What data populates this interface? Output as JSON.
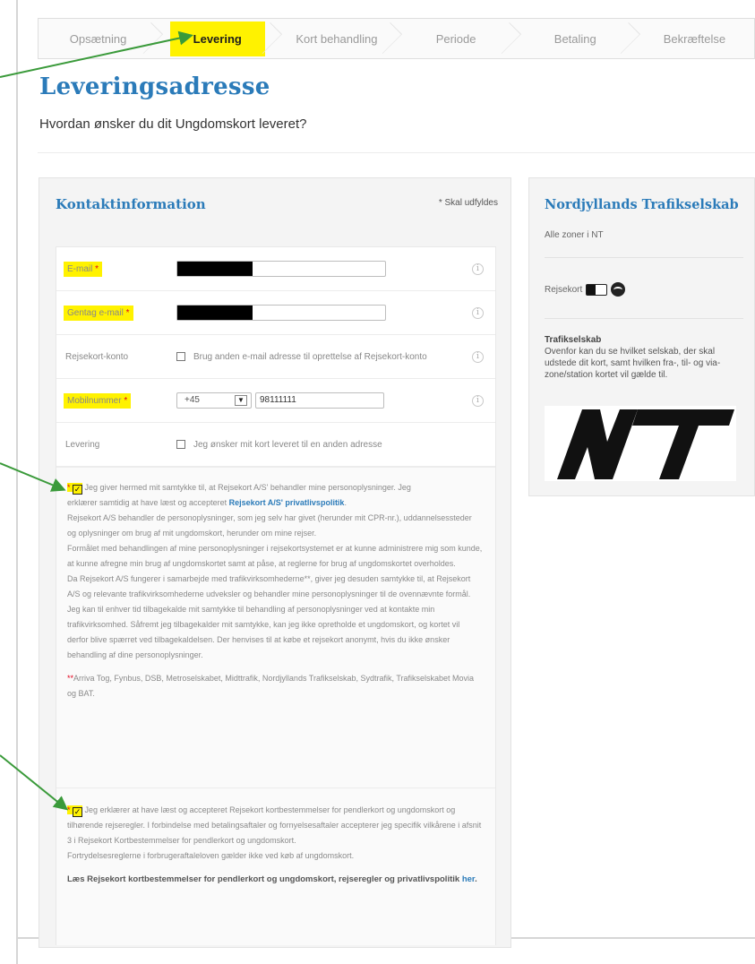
{
  "steps": [
    {
      "label": "Opsætning",
      "active": false
    },
    {
      "label": "Levering",
      "active": true
    },
    {
      "label": "Kort behandling",
      "active": false
    },
    {
      "label": "Periode",
      "active": false
    },
    {
      "label": "Betaling",
      "active": false
    },
    {
      "label": "Bekræftelse",
      "active": false
    }
  ],
  "page": {
    "title": "Leveringsadresse",
    "subtitle": "Hvordan ønsker du dit Ungdomskort leveret?"
  },
  "contact": {
    "title": "Kontaktinformation",
    "required_note": "* Skal udfyldes",
    "email_label": "E-mail",
    "repeat_email_label": "Gentag e-mail",
    "account_label": "Rejsekort-konto",
    "account_checkbox_text": "Brug anden e-mail adresse til oprettelse af Rejsekort-konto",
    "mobile_label": "Mobilnummer",
    "country_code": "+45",
    "mobile_value": "98111111",
    "delivery_label": "Levering",
    "delivery_checkbox_text": "Jeg ønsker mit kort leveret til en anden adresse",
    "required_star": "*"
  },
  "consent1": {
    "line1": "Jeg giver hermed mit samtykke til, at Rejsekort A/S' behandler mine personoplysninger. Jeg",
    "line2_a": "erklærer samtidig at have læst og accepteret ",
    "line2_link": "Rejsekort A/S' privatlivspolitik",
    "p2": "Rejsekort A/S behandler de personoplysninger, som jeg selv har givet (herunder mit CPR-nr.), uddannelsessteder og oplysninger om brug af mit ungdomskort, herunder om mine rejser.",
    "p3": "Formålet med behandlingen af mine personoplysninger i rejsekortsystemet er at kunne administrere mig som kunde, at kunne afregne min brug af ungdomskortet samt at påse, at reglerne for brug af ungdomskortet overholdes.",
    "p4": "Da Rejsekort A/S fungerer i samarbejde med trafikvirksomhederne**, giver jeg desuden samtykke til, at Rejsekort A/S og relevante trafikvirksomhederne udveksler og behandler mine personoplysninger til de ovennævnte formål.",
    "p5": "Jeg kan til enhver tid tilbagekalde mit samtykke til behandling af personoplysninger ved at kontakte min trafikvirksomhed. Såfremt jeg tilbagekalder mit samtykke, kan jeg ikke opretholde et ungdomskort, og kortet vil derfor blive spærret ved tilbagekaldelsen. Der henvises til at købe et rejsekort anonymt, hvis du ikke ønsker behandling af dine personoplysninger.",
    "footnote_mark": "**",
    "footnote": "Arriva Tog, Fynbus, DSB, Metroselskabet, Midttrafik, Nordjyllands Trafikselskab, Sydtrafik, Trafikselskabet Movia og BAT."
  },
  "consent2": {
    "line1": "Jeg erklærer at have læst og accepteret Rejsekort kortbestemmelser for pendlerkort og ungdomskort og tilhørende rejseregler. I forbindelse med betalingsaftaler og fornyelsesaftaler accepterer jeg specifik vilkårene i afsnit 3 i Rejsekort Kortbestemmelser for pendlerkort og ungdomskort.",
    "p2": "Fortrydelsesreglerne i forbrugeraftaleloven gælder ikke ved køb af ungdomskort.",
    "read_text": "Læs Rejsekort kortbestemmelser for pendlerkort og ungdomskort, rejseregler og privatlivspolitik ",
    "read_link": "her"
  },
  "sidebar": {
    "title": "Nordjyllands Trafikselskab",
    "zones": "Alle zoner i NT",
    "rejsekort": "Rejsekort",
    "ts_heading": "Trafikselskab",
    "ts_text": "Ovenfor kan du se hvilket selskab, der skal udstede dit kort, samt hvilken fra-, til- og via-zone/station kortet vil gælde til.",
    "logo_text": "NT"
  },
  "colors": {
    "accent": "#2b7bb9",
    "highlight": "#fff200",
    "arrow": "#3a9a3a",
    "required": "#e2001a"
  }
}
